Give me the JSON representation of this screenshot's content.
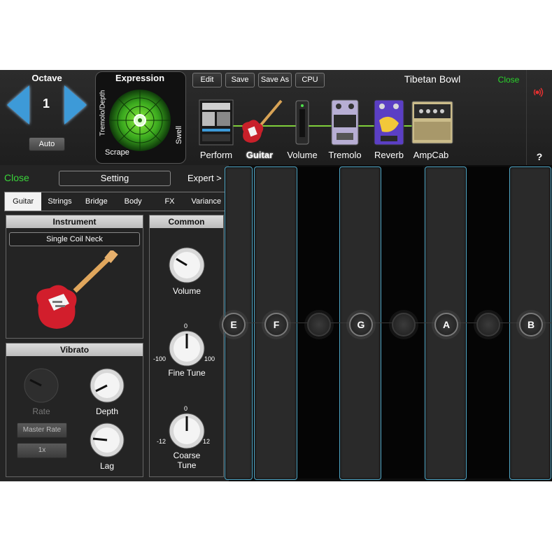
{
  "octave": {
    "title": "Octave",
    "value": "1",
    "auto_label": "Auto"
  },
  "expression": {
    "title": "Expression",
    "left_label": "Tremolo/Depth",
    "bottom_label": "Scrape",
    "right_label": "Swell"
  },
  "toolbar": {
    "edit": "Edit",
    "save": "Save",
    "save_as": "Save As",
    "cpu": "CPU"
  },
  "preset_name": "Tibetan Bowl",
  "close_label": "Close",
  "chain": [
    {
      "label": "Perform",
      "icon": "perform-screen-icon"
    },
    {
      "label": "Guitar",
      "icon": "guitar-icon"
    },
    {
      "label": "Volume",
      "icon": "volume-pedal-icon"
    },
    {
      "label": "Tremolo",
      "icon": "tremolo-pedal-icon"
    },
    {
      "label": "Reverb",
      "icon": "reverb-pedal-icon"
    },
    {
      "label": "AmpCab",
      "icon": "amp-icon"
    }
  ],
  "help_label": "?",
  "panel": {
    "close": "Close",
    "setting": "Setting",
    "expert": "Expert >",
    "tabs": [
      "Guitar",
      "Strings",
      "Bridge",
      "Body",
      "FX",
      "Variance"
    ],
    "active_tab": "Guitar",
    "instrument": {
      "title": "Instrument",
      "selected": "Single Coil Neck"
    },
    "vibrato": {
      "title": "Vibrato",
      "rate_label": "Rate",
      "depth_label": "Depth",
      "lag_label": "Lag",
      "master_rate_label": "Master Rate",
      "multiplier_label": "1x"
    },
    "common": {
      "title": "Common",
      "volume_label": "Volume",
      "fine_tune": {
        "label": "Fine Tune",
        "min": "-100",
        "mid": "0",
        "max": "100"
      },
      "coarse_tune": {
        "label_line1": "Coarse",
        "label_line2": "Tune",
        "min": "-12",
        "mid": "0",
        "max": "12"
      }
    }
  },
  "notes": [
    "E",
    "F",
    "G",
    "A",
    "B"
  ],
  "colors": {
    "accent_blue": "#3d9ad8",
    "close_green": "#29d42b",
    "string_frame": "#4ea6c6"
  }
}
